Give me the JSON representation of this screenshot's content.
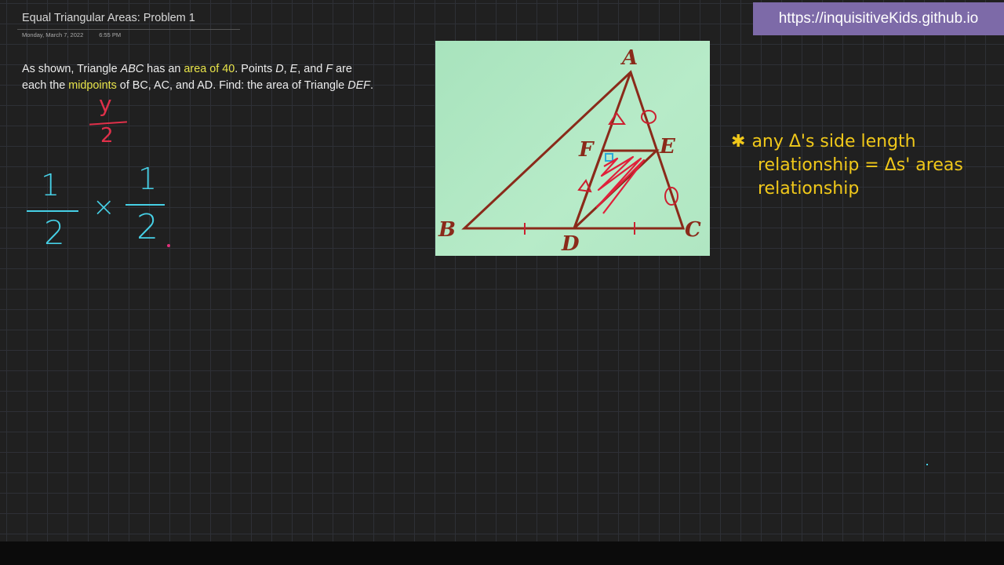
{
  "page": {
    "title": "Equal Triangular Areas: Problem 1",
    "date": "Monday, March 7, 2022",
    "time": "6:55 PM"
  },
  "problem": {
    "p1": "As shown, Triangle ",
    "abc": "ABC",
    "p2": " has an ",
    "area": "area of 40",
    "p3": ". Points ",
    "d": "D",
    "comma1": ", ",
    "e": "E",
    "and1": ", and ",
    "f": "F",
    "p4": " are each the ",
    "midpoints": "midpoints",
    "p5": " of BC, AC, and AD. Find: the area of Triangle ",
    "def": "DEF",
    "end": "."
  },
  "banner": {
    "url": "https://inquisitiveKids.github.io"
  },
  "figure": {
    "labels": {
      "A": "A",
      "B": "B",
      "C": "C",
      "D": "D",
      "E": "E",
      "F": "F"
    }
  },
  "handwriting": {
    "red_fraction": {
      "numerator": "y",
      "denominator": "2"
    },
    "fraction1": {
      "numerator": "1",
      "denominator": "2"
    },
    "times": "×",
    "fraction2": {
      "numerator": "1",
      "denominator": "2"
    }
  },
  "note": {
    "line1": "any Δ's side length",
    "line2": "relationship = Δs' areas",
    "line3": "relationship"
  },
  "colors": {
    "background": "#202020",
    "banner": "#7d6aa8",
    "highlight": "#e8e44a",
    "ink_red": "#e0304a",
    "ink_cyan": "#46d0e6",
    "ink_yellow": "#f0c81a",
    "figure_bg": "#b0e6c2",
    "triangle": "#8a2a1a"
  },
  "icons": {
    "note_marker": "star-icon"
  }
}
